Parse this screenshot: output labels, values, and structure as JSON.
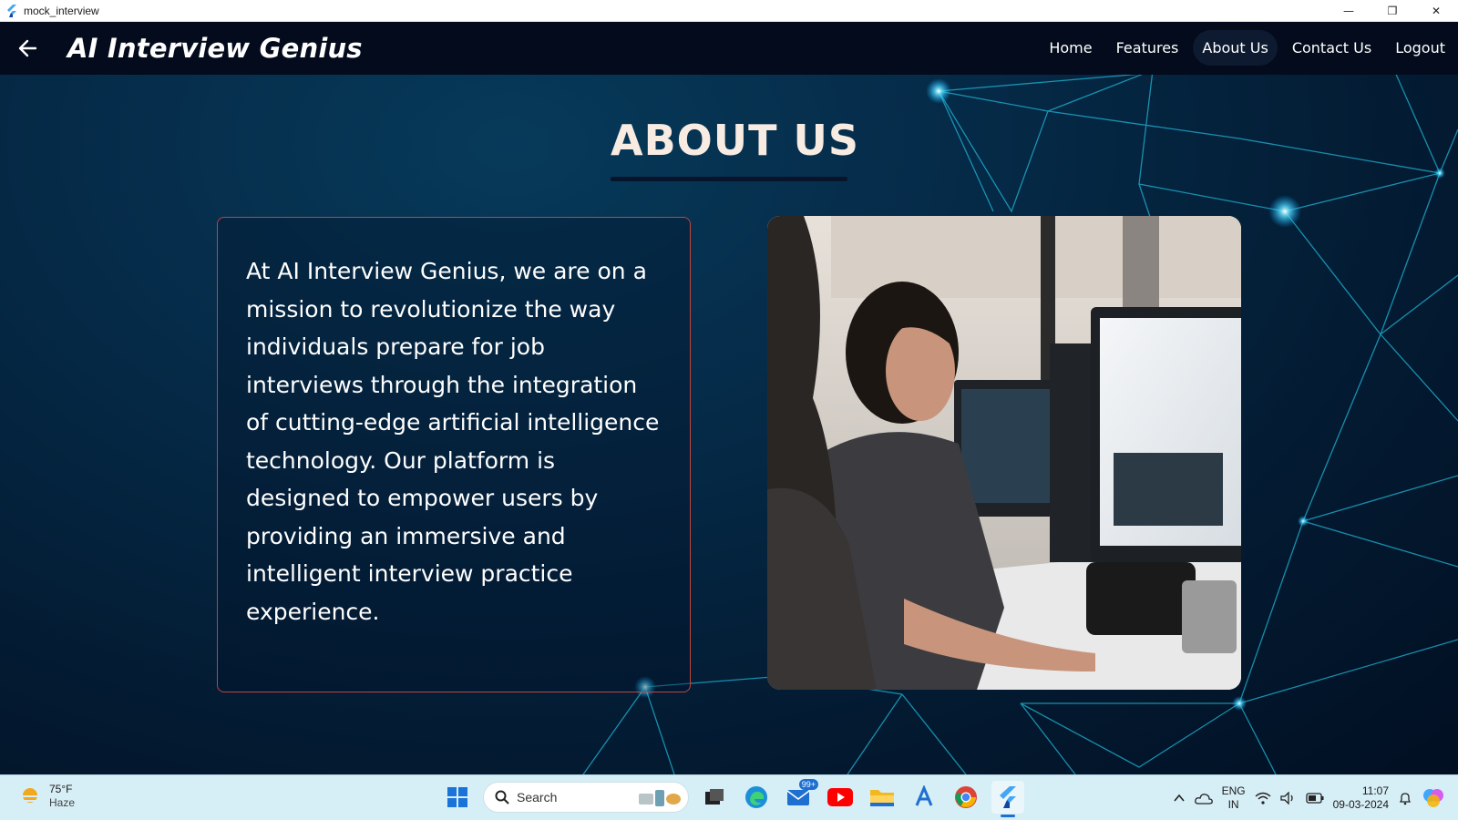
{
  "window": {
    "title": "mock_interview",
    "minimize_symbol": "—",
    "restore_symbol": "❐",
    "close_symbol": "✕"
  },
  "appbar": {
    "title": "AI Interview Genius",
    "back_icon": "arrow-left-icon",
    "nav": [
      {
        "label": "Home",
        "active": false
      },
      {
        "label": "Features",
        "active": false
      },
      {
        "label": "About Us",
        "active": true
      },
      {
        "label": "Contact Us",
        "active": false
      },
      {
        "label": "Logout",
        "active": false
      }
    ]
  },
  "main": {
    "heading": "ABOUT US",
    "mission_text": "At AI Interview Genius, we are on a mission to revolutionize the way individuals prepare for job interviews through the integration of cutting-edge artificial intelligence technology. Our platform is designed to empower users by providing an immersive and intelligent interview practice experience.",
    "photo_icon": "office-photo-icon"
  },
  "taskbar": {
    "weather": {
      "temp": "75°F",
      "condition": "Haze"
    },
    "search_placeholder": "Search",
    "mail_badge": "99+",
    "language": {
      "line1": "ENG",
      "line2": "IN"
    },
    "time": "11:07",
    "date": "09-03-2024"
  },
  "colors": {
    "appbar_bg": "#030b1c",
    "card_border": "#c0443f",
    "heading": "#f7ebe2",
    "taskbar_bg": "#d6eef5"
  }
}
